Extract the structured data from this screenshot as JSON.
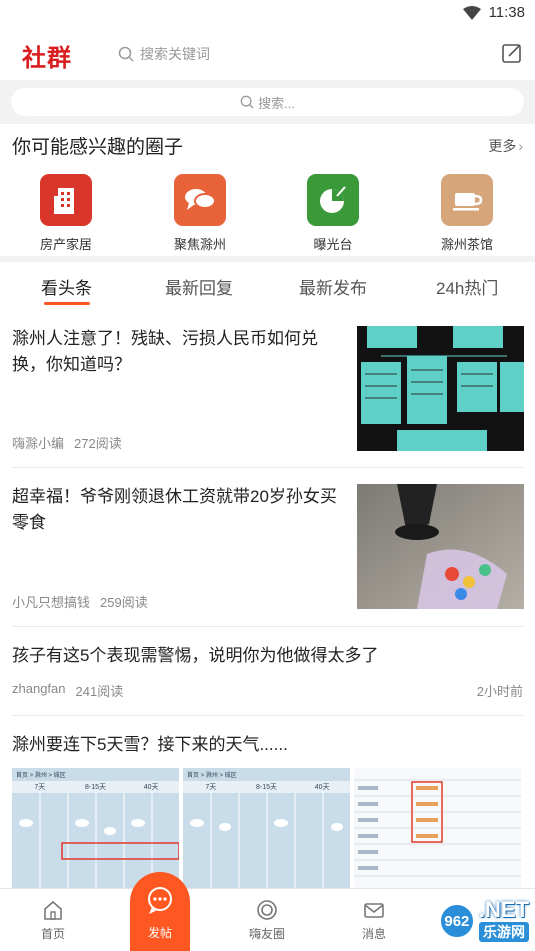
{
  "status": {
    "time": "11:38"
  },
  "header": {
    "logo": "社群",
    "search_placeholder": "搜索关键词"
  },
  "search": {
    "placeholder": "搜索..."
  },
  "circles": {
    "title": "你可能感兴趣的圈子",
    "more": "更多",
    "items": [
      {
        "label": "房产家居",
        "icon": "building-icon",
        "color": "#d8362a"
      },
      {
        "label": "聚焦滁州",
        "icon": "chat-bubbles-icon",
        "color": "#e8623a"
      },
      {
        "label": "曝光台",
        "icon": "pie-chart-icon",
        "color": "#3a9a3a"
      },
      {
        "label": "滁州茶馆",
        "icon": "tea-cup-icon",
        "color": "#d6a67a"
      }
    ]
  },
  "tabs": [
    {
      "label": "看头条",
      "active": true
    },
    {
      "label": "最新回复",
      "active": false
    },
    {
      "label": "最新发布",
      "active": false
    },
    {
      "label": "24h热门",
      "active": false
    }
  ],
  "feed": [
    {
      "title": "滁州人注意了！残缺、污损人民币如何兑换，你知道吗？",
      "author": "嗨滁小编",
      "reads": "272阅读"
    },
    {
      "title": "超幸福！爷爷刚领退休工资就带20岁孙女买零食",
      "author": "小凡只想搞钱",
      "reads": "259阅读"
    },
    {
      "title": "孩子有这5个表现需警惕，说明你为他做得太多了",
      "author": "zhangfan",
      "reads": "241阅读",
      "time": "2小时前"
    },
    {
      "title": "滁州要连下5天雪？接下来的天气......"
    }
  ],
  "weather_thumb": {
    "breadcrumb": "首页 > 滁州 > 城区",
    "tabs": [
      "7天",
      "8-15天",
      "40天"
    ]
  },
  "bottom_nav": [
    {
      "label": "首页",
      "icon": "home-icon"
    },
    {
      "label": "发帖",
      "icon": "chat-dots-icon"
    },
    {
      "label": "嗨友圈",
      "icon": "circle-icon"
    },
    {
      "label": "消息",
      "icon": "mail-icon"
    }
  ],
  "watermark": {
    "badge": "962",
    "text": ".NET",
    "sub": "乐游网"
  },
  "colors": {
    "brand": "#d81e1e",
    "accent": "#ff5722"
  }
}
